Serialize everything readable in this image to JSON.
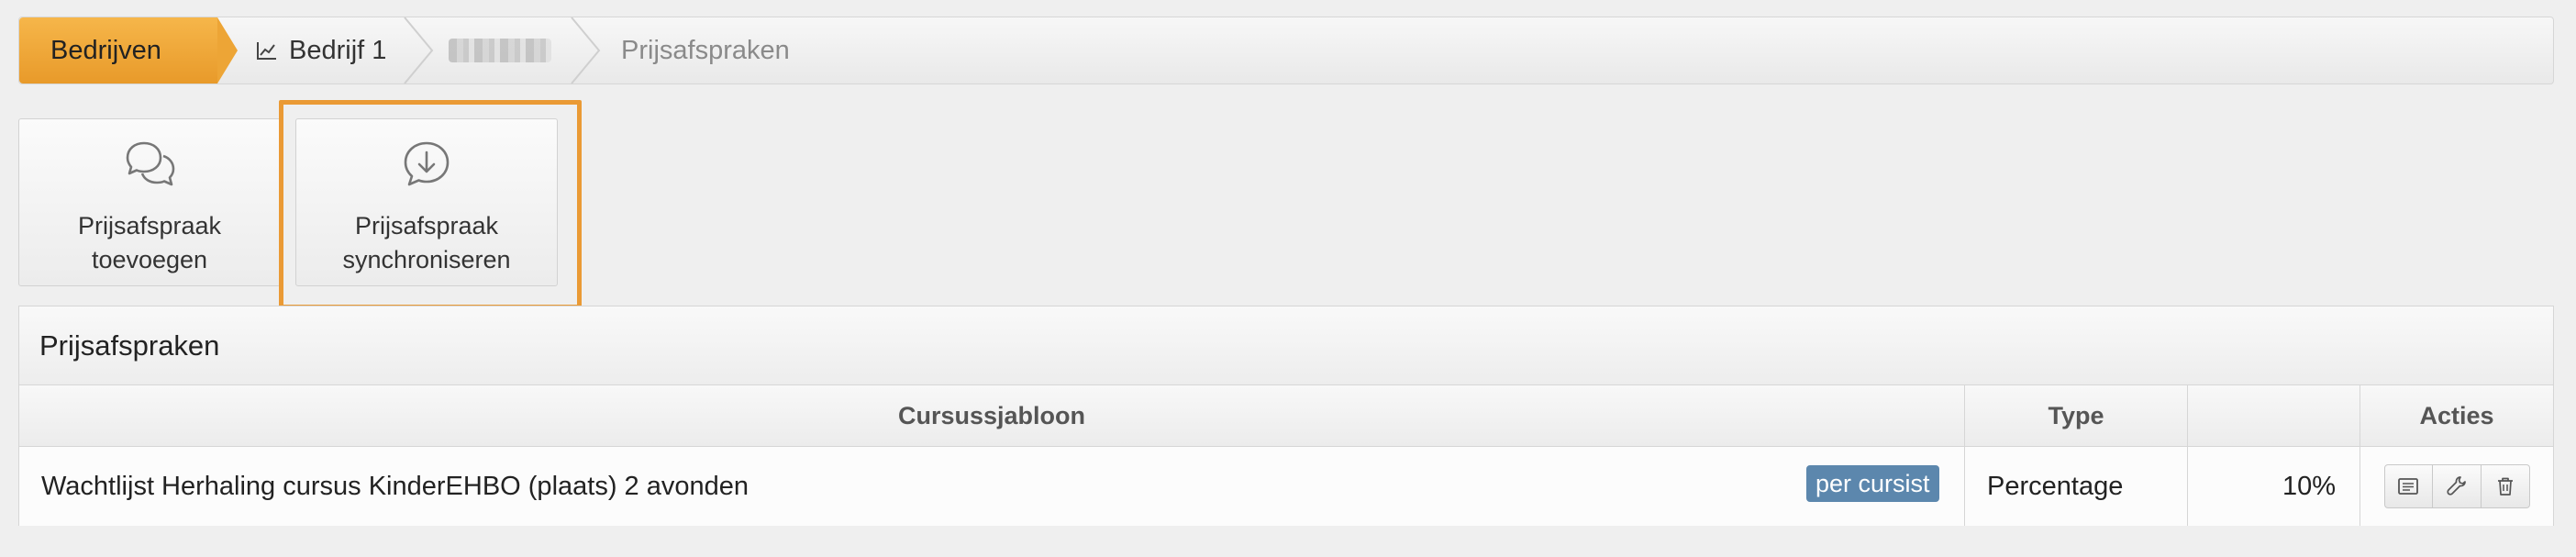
{
  "breadcrumb": {
    "items": [
      {
        "label": "Bedrijven"
      },
      {
        "label": "Bedrijf 1",
        "icon": "chart-icon"
      },
      {
        "label": "",
        "blurred": true
      },
      {
        "label": "Prijsafspraken"
      }
    ]
  },
  "actions": {
    "add": {
      "label": "Prijsafspraak\ntoevoegen",
      "icon": "chat-bubbles-icon"
    },
    "sync": {
      "label": "Prijsafspraak\nsynchroniseren",
      "icon": "download-bubble-icon"
    }
  },
  "panel": {
    "title": "Prijsafspraken",
    "columns": [
      "Cursussjabloon",
      "Type",
      "",
      "Acties"
    ],
    "rows": [
      {
        "template": "Wachtlijst Herhaling cursus KinderEHBO (plaats) 2 avonden",
        "badge": "per cursist",
        "type": "Percentage",
        "value": "10%",
        "actions": [
          "details-icon",
          "wrench-icon",
          "trash-icon"
        ]
      }
    ]
  },
  "colors": {
    "accent": "#ea9a35",
    "breadcrumb_active": "#eda536",
    "badge": "#5c87ad"
  }
}
